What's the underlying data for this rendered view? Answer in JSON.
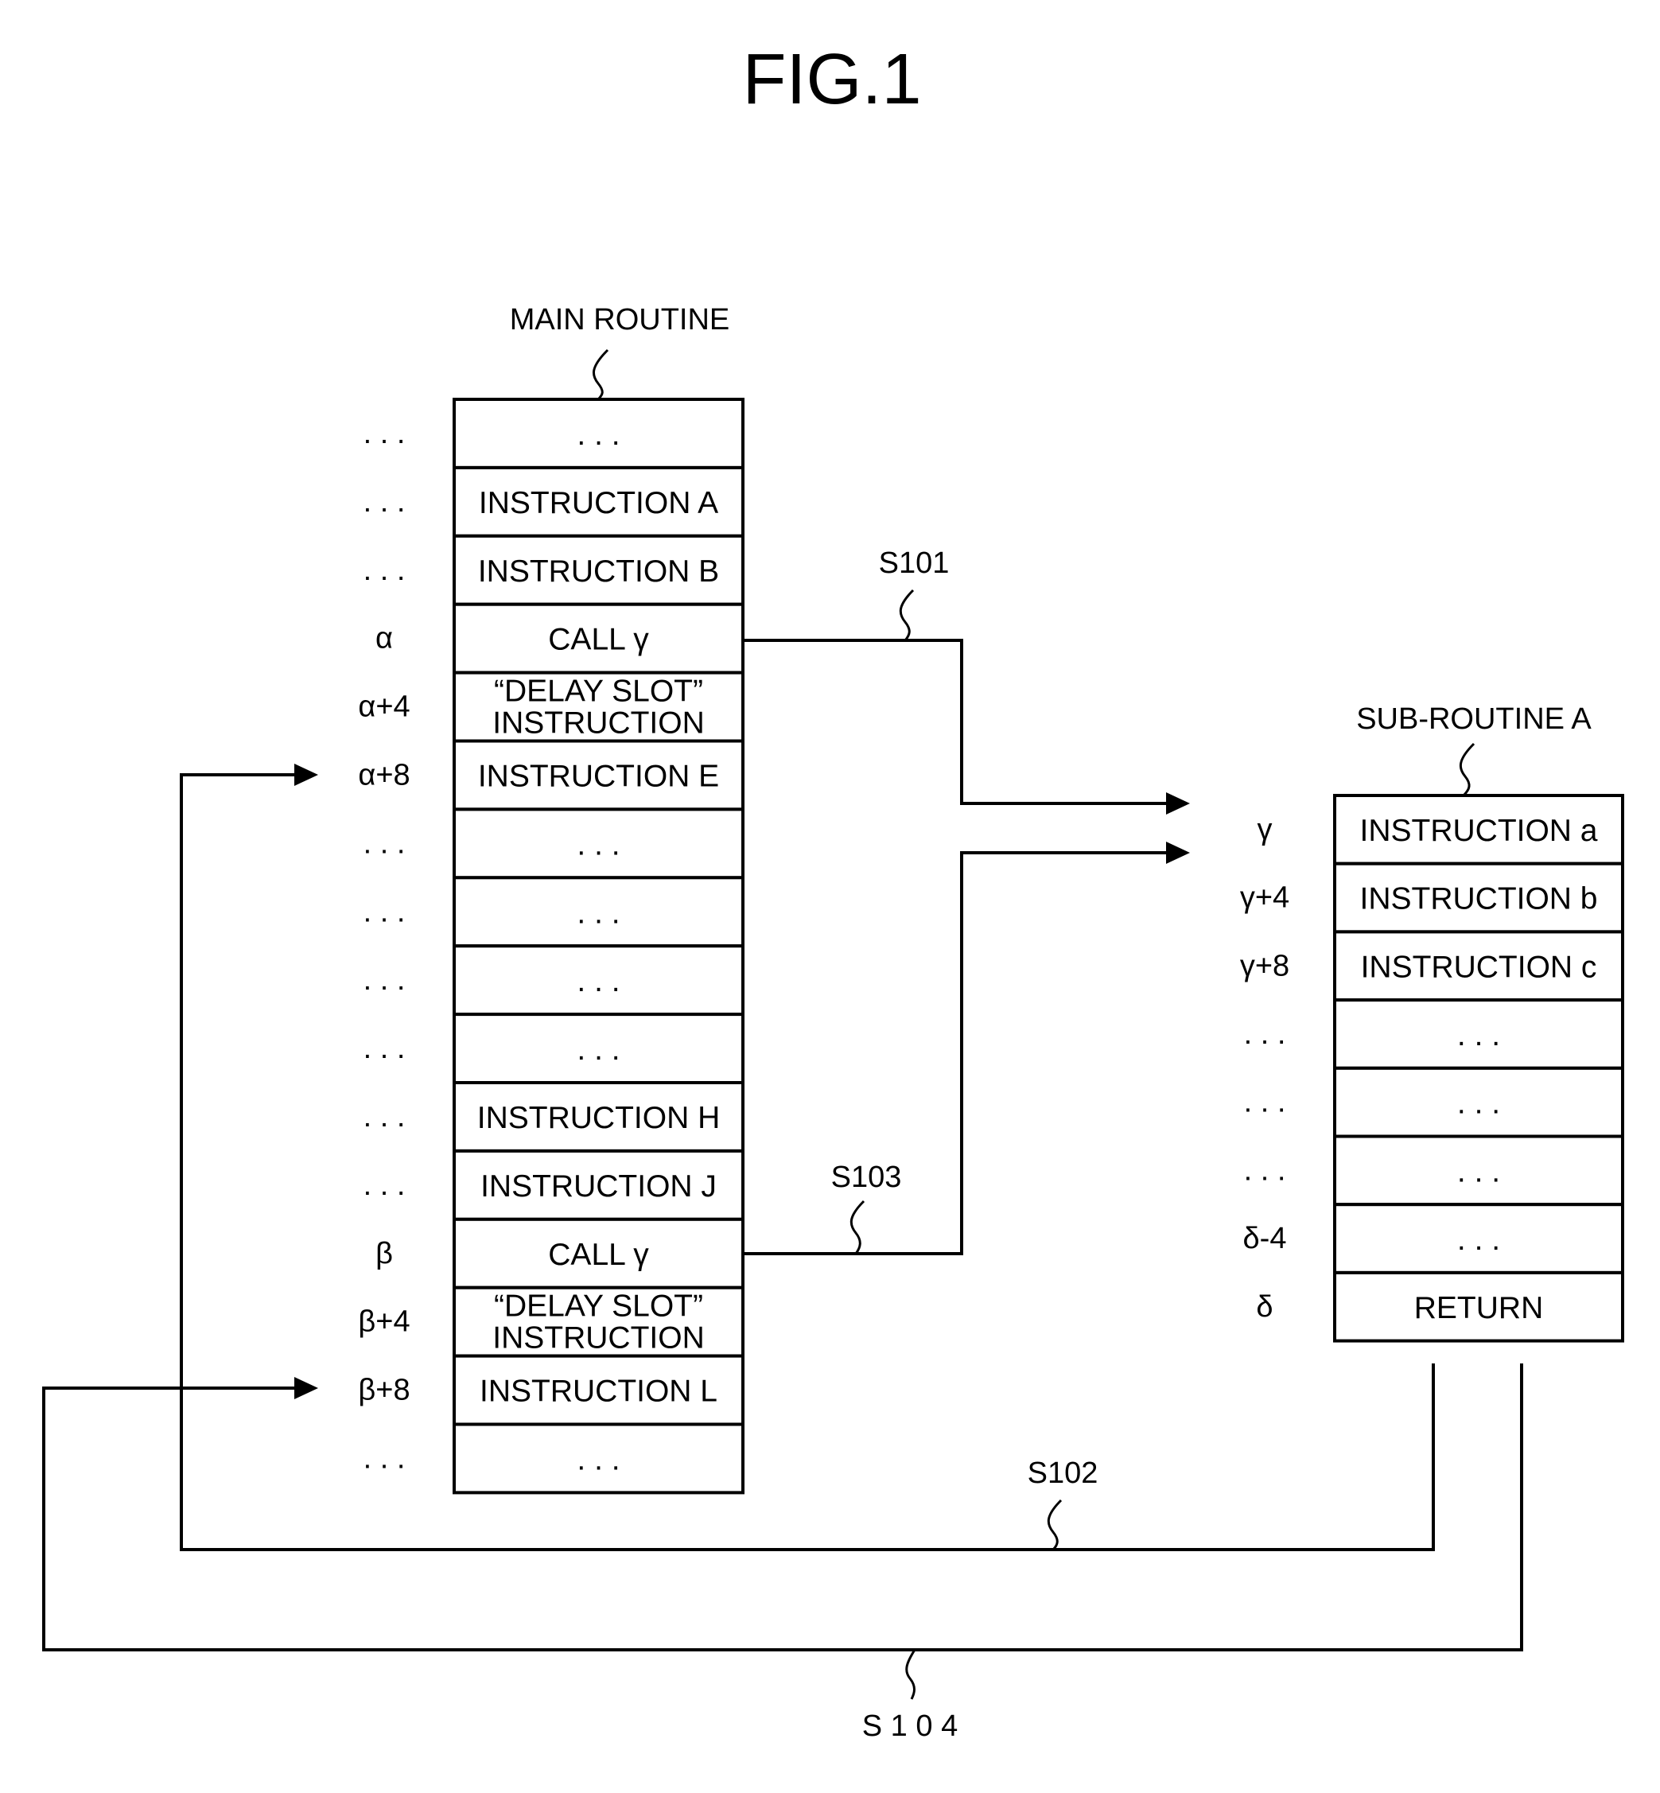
{
  "figure": {
    "title": "FIG.1"
  },
  "main_routine": {
    "label": "MAIN ROUTINE",
    "rows": [
      {
        "addr": ". . .",
        "text": [
          ". . ."
        ]
      },
      {
        "addr": ". . .",
        "text": [
          "INSTRUCTION A"
        ]
      },
      {
        "addr": ". . .",
        "text": [
          "INSTRUCTION B"
        ]
      },
      {
        "addr": "α",
        "text": [
          "CALL γ"
        ]
      },
      {
        "addr": "α+4",
        "text": [
          "“DELAY SLOT”",
          "INSTRUCTION"
        ]
      },
      {
        "addr": "α+8",
        "text": [
          "INSTRUCTION E"
        ]
      },
      {
        "addr": ". . .",
        "text": [
          ". . ."
        ]
      },
      {
        "addr": ". . .",
        "text": [
          ". . ."
        ]
      },
      {
        "addr": ". . .",
        "text": [
          ". . ."
        ]
      },
      {
        "addr": ". . .",
        "text": [
          ". . ."
        ]
      },
      {
        "addr": ". . .",
        "text": [
          "INSTRUCTION H"
        ]
      },
      {
        "addr": ". . .",
        "text": [
          "INSTRUCTION J"
        ]
      },
      {
        "addr": "β",
        "text": [
          "CALL γ"
        ]
      },
      {
        "addr": "β+4",
        "text": [
          "“DELAY SLOT”",
          "INSTRUCTION"
        ]
      },
      {
        "addr": "β+8",
        "text": [
          "INSTRUCTION L"
        ]
      },
      {
        "addr": ". . .",
        "text": [
          ". . ."
        ]
      }
    ]
  },
  "sub_routine": {
    "label": "SUB-ROUTINE A",
    "rows": [
      {
        "addr": "γ",
        "text": [
          "INSTRUCTION a"
        ]
      },
      {
        "addr": "γ+4",
        "text": [
          "INSTRUCTION b"
        ]
      },
      {
        "addr": "γ+8",
        "text": [
          "INSTRUCTION c"
        ]
      },
      {
        "addr": ". . .",
        "text": [
          ". . ."
        ]
      },
      {
        "addr": ". . .",
        "text": [
          ". . ."
        ]
      },
      {
        "addr": ". . .",
        "text": [
          ". . ."
        ]
      },
      {
        "addr": "δ-4",
        "text": [
          ". . ."
        ]
      },
      {
        "addr": "δ",
        "text": [
          "RETURN"
        ]
      }
    ]
  },
  "steps": {
    "s101": "S101",
    "s102": "S102",
    "s103": "S103",
    "s104": "S 1 0 4"
  }
}
